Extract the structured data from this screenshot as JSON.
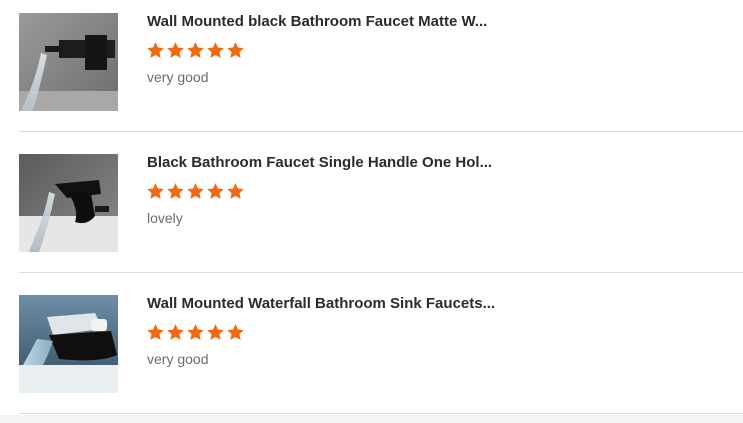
{
  "reviews": [
    {
      "title": "Wall Mounted black Bathroom Faucet Matte W...",
      "rating": 5,
      "comment": "very good"
    },
    {
      "title": "Black Bathroom Faucet Single Handle One Hol...",
      "rating": 5,
      "comment": "lovely"
    },
    {
      "title": "Wall Mounted Waterfall Bathroom Sink Faucets...",
      "rating": 5,
      "comment": "very good"
    }
  ],
  "colors": {
    "star": "#f26a10",
    "title": "#2b2b2b",
    "comment": "#6b6b6b",
    "divider": "#dcdcdc"
  },
  "icons": {
    "rating": "star-icon"
  }
}
